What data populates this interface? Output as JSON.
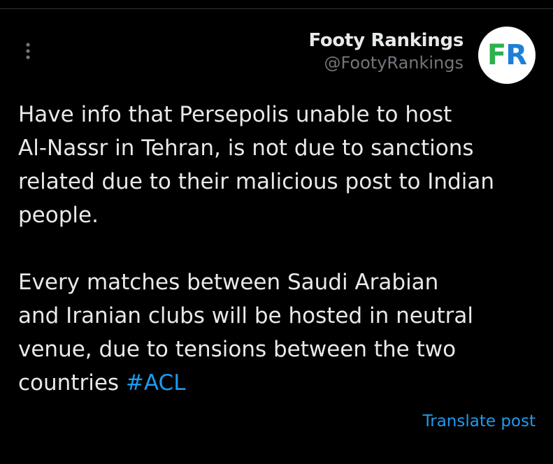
{
  "author": {
    "display_name": "Footy Rankings",
    "handle": "@FootyRankings",
    "avatar_letters": [
      "F",
      "R"
    ]
  },
  "tweet": {
    "paragraph_1": "Have info that Persepolis unable to host\nAl-Nassr in Tehran, is not due to sanctions\nrelated due to their malicious post to Indian\npeople.",
    "paragraph_2": "Every matches between Saudi Arabian\nand Iranian clubs will be hosted in neutral\nvenue, due to tensions between the two\ncountries ",
    "hashtag": "#ACL"
  },
  "actions": {
    "translate_label": "Translate post",
    "more_icon": "more-vertical-icon"
  },
  "colors": {
    "background": "#000000",
    "text": "#e7e9ea",
    "secondary_text": "#71767b",
    "link": "#1d9bf0",
    "avatar_f": "#2bb24c",
    "avatar_r": "#1d7fd8"
  }
}
